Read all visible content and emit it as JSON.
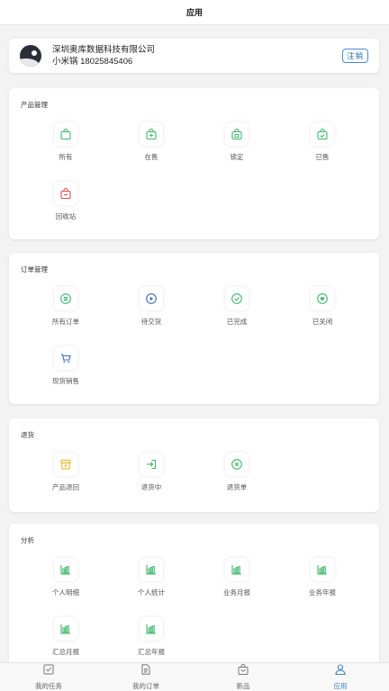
{
  "header": {
    "title": "应用"
  },
  "profile": {
    "company": "深圳奥库数据科技有限公司",
    "user": "小米锅 18025845406",
    "logout_label": "注销"
  },
  "sections": {
    "product": {
      "title": "产品管理",
      "items": [
        {
          "label": "所有",
          "icon": "bag-icon",
          "color": "#3fb86b"
        },
        {
          "label": "在售",
          "icon": "bag-plus-icon",
          "color": "#3fb86b"
        },
        {
          "label": "锁定",
          "icon": "bag-lock-icon",
          "color": "#3fb86b"
        },
        {
          "label": "已售",
          "icon": "bag-check-icon",
          "color": "#3fb86b"
        },
        {
          "label": "回收站",
          "icon": "bag-minus-icon",
          "color": "#d9534f"
        }
      ]
    },
    "orders": {
      "title": "订单管理",
      "items": [
        {
          "label": "所有订单",
          "icon": "list-circle-icon",
          "color": "#3fb86b"
        },
        {
          "label": "待交货",
          "icon": "play-circle-icon",
          "color": "#3b6fb0"
        },
        {
          "label": "已完成",
          "icon": "check-circle-icon",
          "color": "#3fb86b"
        },
        {
          "label": "已关闭",
          "icon": "heart-circle-icon",
          "color": "#3fb86b"
        },
        {
          "label": "现货销售",
          "icon": "cart-icon",
          "color": "#3b6fb0"
        }
      ]
    },
    "returns": {
      "title": "退货",
      "items": [
        {
          "label": "产品退回",
          "icon": "archive-icon",
          "color": "#e8b92a"
        },
        {
          "label": "退货中",
          "icon": "enter-icon",
          "color": "#3fb86b"
        },
        {
          "label": "退货单",
          "icon": "x-circle-icon",
          "color": "#3fb86b"
        }
      ]
    },
    "analysis": {
      "title": "分析",
      "items": [
        {
          "label": "个人明细",
          "icon": "bar-chart-icon",
          "color": "#3fb86b"
        },
        {
          "label": "个人统计",
          "icon": "bar-chart-icon",
          "color": "#3fb86b"
        },
        {
          "label": "业务月报",
          "icon": "bar-chart-icon",
          "color": "#3fb86b"
        },
        {
          "label": "业务年报",
          "icon": "bar-chart-icon",
          "color": "#3fb86b"
        },
        {
          "label": "汇总月报",
          "icon": "bar-chart-icon",
          "color": "#3fb86b"
        },
        {
          "label": "汇总年报",
          "icon": "bar-chart-icon",
          "color": "#3fb86b"
        }
      ]
    }
  },
  "tabbar": {
    "items": [
      {
        "label": "我的任务",
        "icon": "task-check-icon"
      },
      {
        "label": "我的订单",
        "icon": "document-icon"
      },
      {
        "label": "新品",
        "icon": "shopping-bag-icon"
      },
      {
        "label": "应用",
        "icon": "person-icon",
        "active": true
      }
    ],
    "active_color": "#3b82c4"
  }
}
